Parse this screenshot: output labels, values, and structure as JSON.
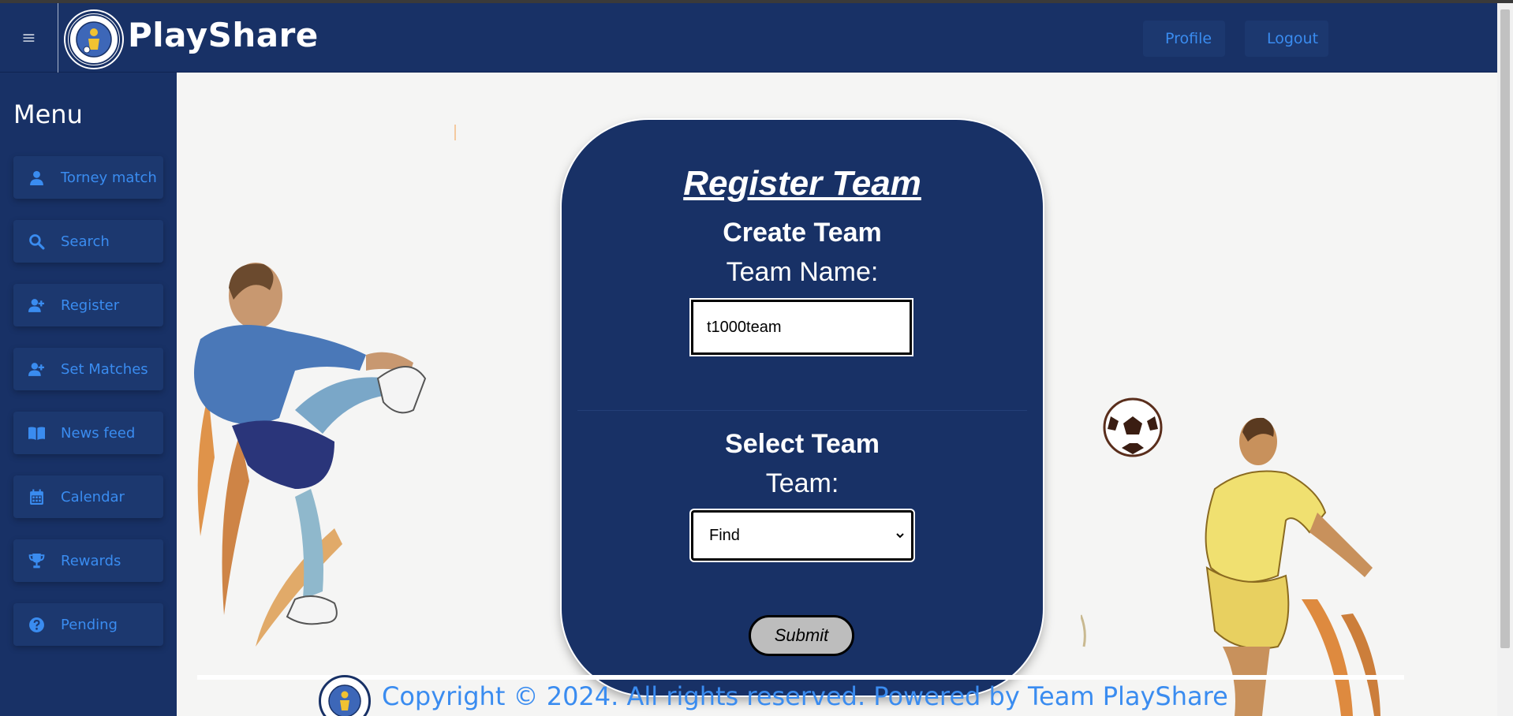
{
  "header": {
    "brand": "PlayShare",
    "profile_label": "Profile",
    "logout_label": "Logout"
  },
  "sidebar": {
    "title": "Menu",
    "items": [
      {
        "label": "Torney match",
        "icon": "user-icon"
      },
      {
        "label": "Search",
        "icon": "search-icon"
      },
      {
        "label": "Register",
        "icon": "user-plus-icon"
      },
      {
        "label": "Set Matches",
        "icon": "user-plus-icon"
      },
      {
        "label": "News feed",
        "icon": "book-open-icon"
      },
      {
        "label": "Calendar",
        "icon": "calendar-icon"
      },
      {
        "label": "Rewards",
        "icon": "trophy-icon"
      },
      {
        "label": "Pending",
        "icon": "question-circle-icon"
      }
    ]
  },
  "form": {
    "title": "Register Team",
    "create_title": "Create Team",
    "team_name_label": "Team Name:",
    "team_name_value": "t1000team",
    "select_title": "Select Team",
    "team_label": "Team:",
    "team_select_value": "Find",
    "submit_label": "Submit"
  },
  "footer": {
    "text": "Copyright © 2024. All rights reserved. Powered by Team PlayShare"
  },
  "colors": {
    "navy": "#183166",
    "accent_blue": "#3a8cf0",
    "white": "#ffffff"
  }
}
